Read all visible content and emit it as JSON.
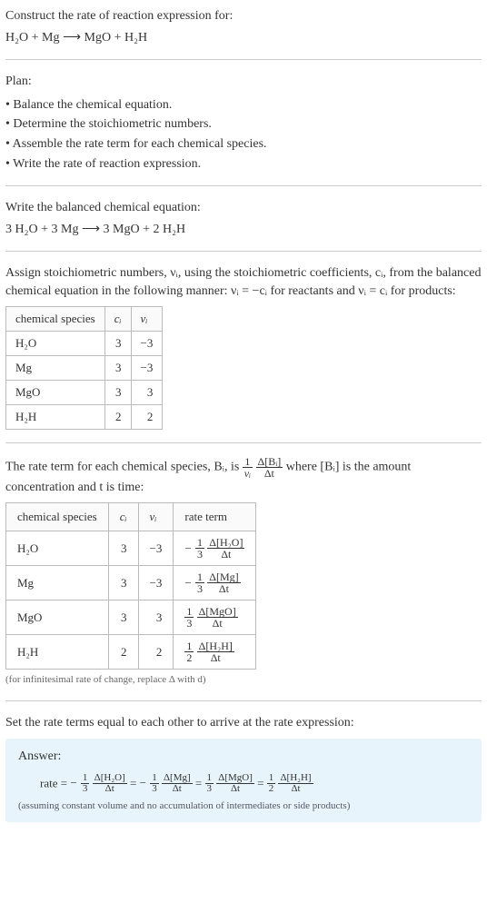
{
  "title": "Construct the rate of reaction expression for:",
  "unbalanced_equation": "H₂O + Mg ⟶ MgO + H₂H",
  "plan_heading": "Plan:",
  "plan_items": [
    "Balance the chemical equation.",
    "Determine the stoichiometric numbers.",
    "Assemble the rate term for each chemical species.",
    "Write the rate of reaction expression."
  ],
  "balanced_heading": "Write the balanced chemical equation:",
  "balanced_equation": "3 H₂O + 3 Mg ⟶ 3 MgO + 2 H₂H",
  "stoich_heading_1": "Assign stoichiometric numbers, νᵢ, using the stoichiometric coefficients, cᵢ, from the balanced chemical equation in the following manner: νᵢ = −cᵢ for reactants and νᵢ = cᵢ for products:",
  "stoich_table": {
    "headers": [
      "chemical species",
      "cᵢ",
      "νᵢ"
    ],
    "rows": [
      {
        "species": "H₂O",
        "c": "3",
        "v": "−3"
      },
      {
        "species": "Mg",
        "c": "3",
        "v": "−3"
      },
      {
        "species": "MgO",
        "c": "3",
        "v": "3"
      },
      {
        "species": "H₂H",
        "c": "2",
        "v": "2"
      }
    ]
  },
  "rate_term_intro_1": "The rate term for each chemical species, Bᵢ, is ",
  "rate_term_intro_frac1_num": "1",
  "rate_term_intro_frac1_den": "νᵢ",
  "rate_term_intro_frac2_num": "Δ[Bᵢ]",
  "rate_term_intro_frac2_den": "Δt",
  "rate_term_intro_2": " where [Bᵢ] is the amount concentration and t is time:",
  "rate_table": {
    "headers": [
      "chemical species",
      "cᵢ",
      "νᵢ",
      "rate term"
    ],
    "rows": [
      {
        "species": "H₂O",
        "c": "3",
        "v": "−3",
        "sign": "−",
        "coef_num": "1",
        "coef_den": "3",
        "deriv_num": "Δ[H₂O]",
        "deriv_den": "Δt"
      },
      {
        "species": "Mg",
        "c": "3",
        "v": "−3",
        "sign": "−",
        "coef_num": "1",
        "coef_den": "3",
        "deriv_num": "Δ[Mg]",
        "deriv_den": "Δt"
      },
      {
        "species": "MgO",
        "c": "3",
        "v": "3",
        "sign": "",
        "coef_num": "1",
        "coef_den": "3",
        "deriv_num": "Δ[MgO]",
        "deriv_den": "Δt"
      },
      {
        "species": "H₂H",
        "c": "2",
        "v": "2",
        "sign": "",
        "coef_num": "1",
        "coef_den": "2",
        "deriv_num": "Δ[H₂H]",
        "deriv_den": "Δt"
      }
    ]
  },
  "rate_table_note": "(for infinitesimal rate of change, replace Δ with d)",
  "set_equal_heading": "Set the rate terms equal to each other to arrive at the rate expression:",
  "answer_label": "Answer:",
  "answer_rate_prefix": "rate = ",
  "answer_terms": [
    {
      "sign": "−",
      "coef_num": "1",
      "coef_den": "3",
      "deriv_num": "Δ[H₂O]",
      "deriv_den": "Δt"
    },
    {
      "sign": "−",
      "coef_num": "1",
      "coef_den": "3",
      "deriv_num": "Δ[Mg]",
      "deriv_den": "Δt"
    },
    {
      "sign": "",
      "coef_num": "1",
      "coef_den": "3",
      "deriv_num": "Δ[MgO]",
      "deriv_den": "Δt"
    },
    {
      "sign": "",
      "coef_num": "1",
      "coef_den": "2",
      "deriv_num": "Δ[H₂H]",
      "deriv_den": "Δt"
    }
  ],
  "answer_note": "(assuming constant volume and no accumulation of intermediates or side products)"
}
